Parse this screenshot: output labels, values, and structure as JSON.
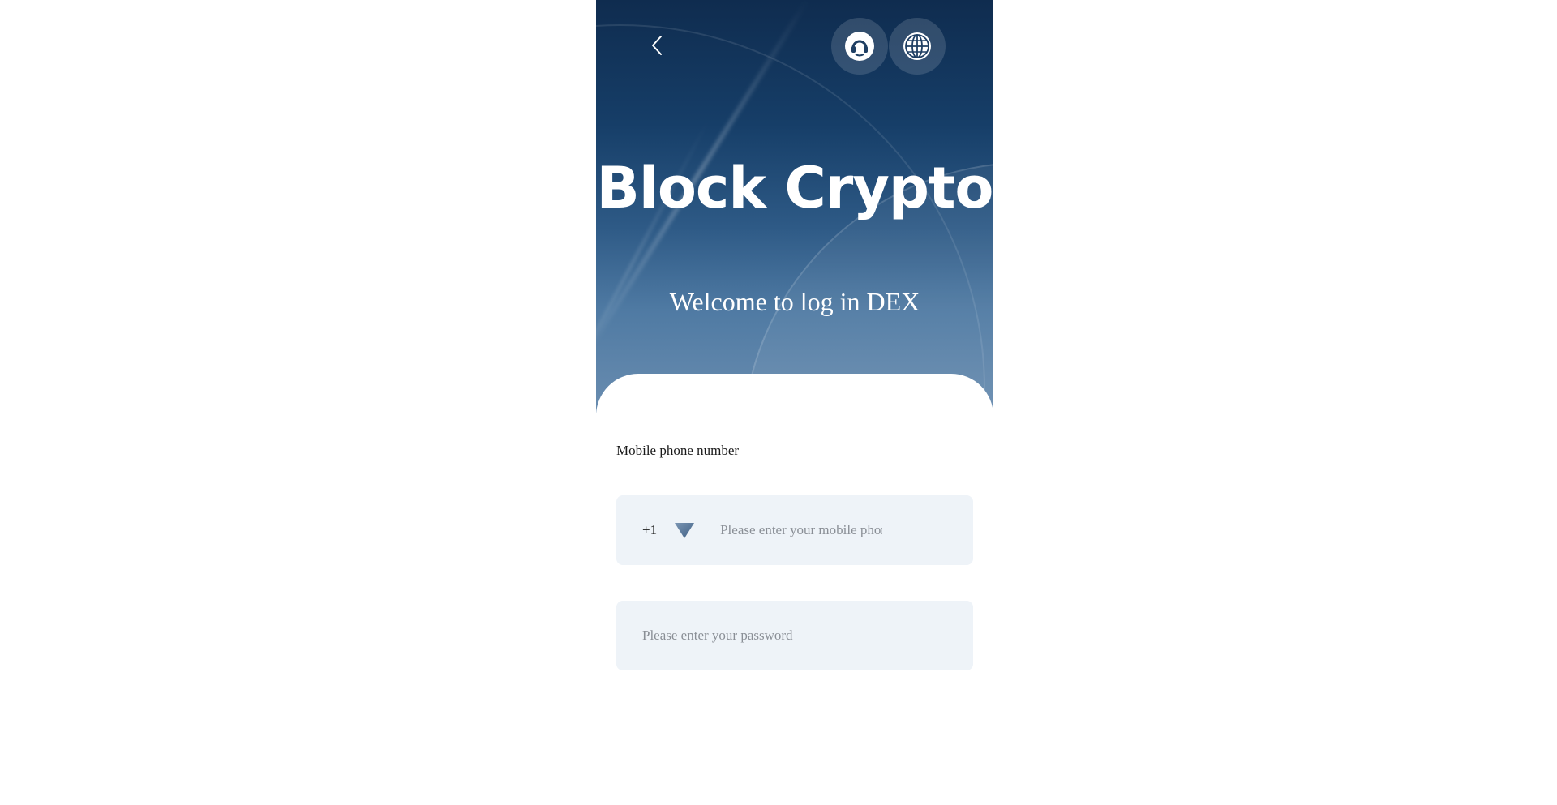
{
  "header": {
    "back_icon": "chevron-left-icon",
    "support_icon": "customer-service-icon",
    "language_icon": "globe-icon"
  },
  "hero": {
    "brand": "Block Crypto",
    "welcome": "Welcome to log in DEX"
  },
  "form": {
    "phone_label": "Mobile phone number",
    "country_code": "+1",
    "dropdown_icon": "triangle-down-icon",
    "phone_placeholder": "Please enter your mobile phone number",
    "password_placeholder": "Please enter your password"
  },
  "colors": {
    "hero_dark": "#0f2c4f",
    "hero_light": "#6a8db0",
    "input_bg": "#eef3f8",
    "accent_arrow": "#4f6f91"
  }
}
